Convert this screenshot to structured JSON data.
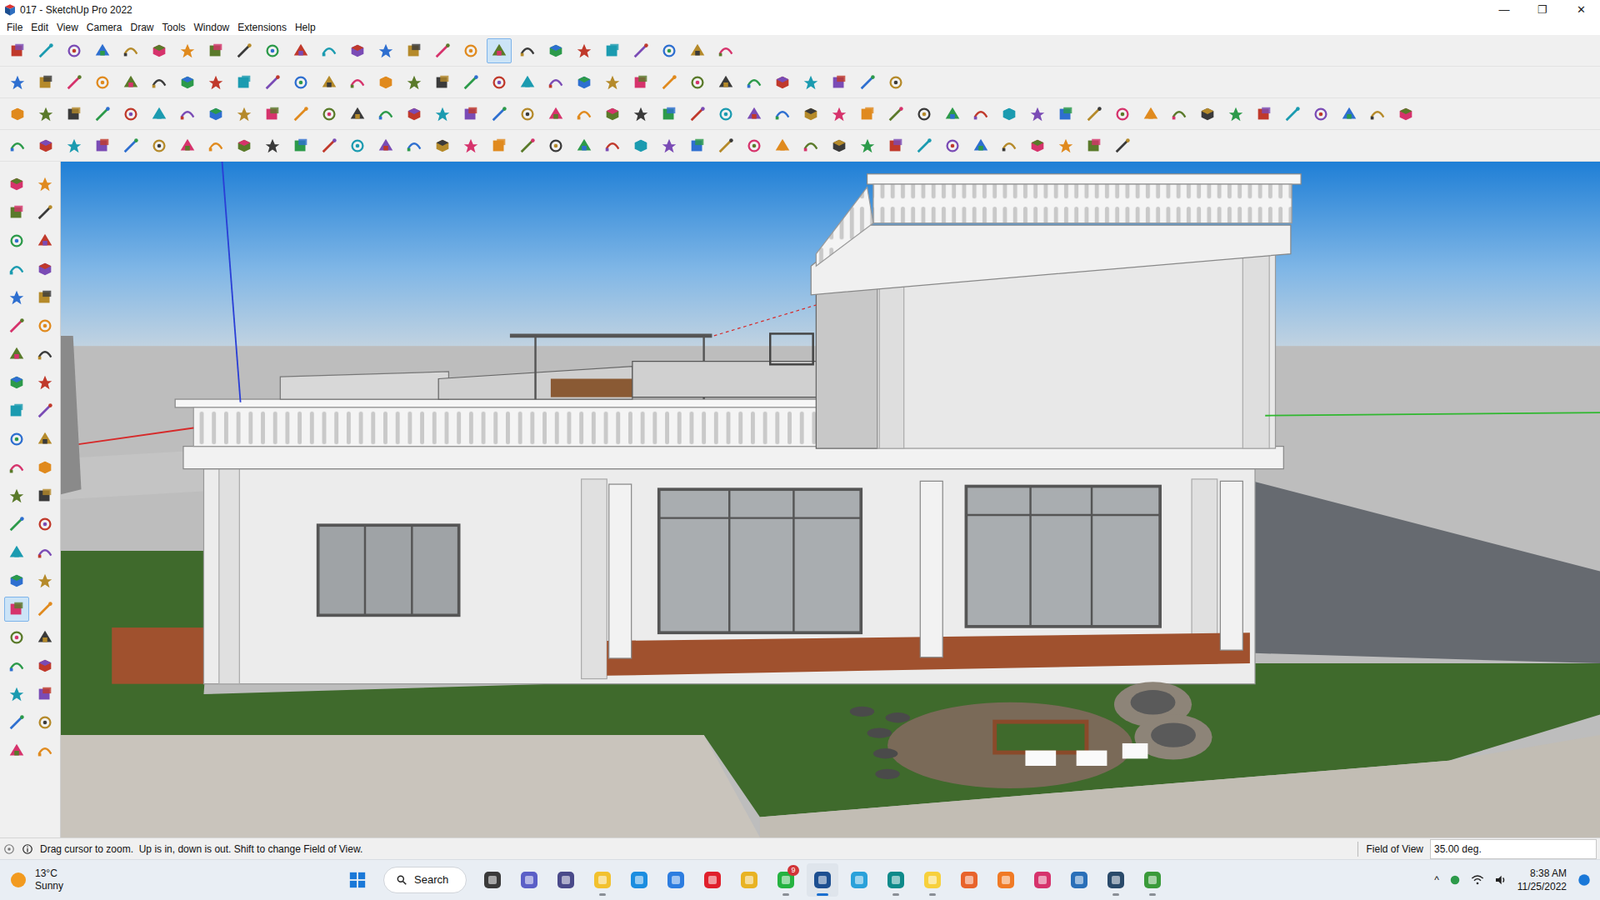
{
  "window": {
    "title": "017 - SketchUp Pro 2022",
    "controls": [
      "—",
      "❐",
      "✕"
    ]
  },
  "menu": [
    "File",
    "Edit",
    "View",
    "Camera",
    "Draw",
    "Tools",
    "Window",
    "Extensions",
    "Help"
  ],
  "toolbar_rows": [
    [
      false,
      false,
      false,
      false,
      false,
      false,
      false,
      false,
      false,
      false,
      false,
      false,
      false,
      false,
      false,
      false,
      false,
      true,
      false,
      false,
      false,
      false,
      false,
      false,
      false,
      false
    ],
    [
      false,
      false,
      false,
      false,
      false,
      false,
      false,
      false,
      false,
      false,
      false,
      false,
      false,
      false,
      false,
      false,
      false,
      false,
      false,
      false,
      false,
      false,
      false,
      false,
      false,
      false,
      false,
      false,
      false,
      false,
      false,
      false
    ],
    [
      false,
      false,
      false,
      false,
      false,
      false,
      false,
      false,
      false,
      false,
      false,
      false,
      false,
      false,
      false,
      false,
      false,
      false,
      false,
      false,
      false,
      false,
      false,
      false,
      false,
      false,
      false,
      false,
      false,
      false,
      false,
      false,
      false,
      false,
      false,
      false,
      false,
      false,
      false,
      false,
      false,
      false,
      false,
      false,
      false,
      false,
      false,
      false,
      false,
      false
    ],
    [
      false,
      false,
      false,
      false,
      false,
      false,
      false,
      false,
      false,
      false,
      false,
      false,
      false,
      false,
      false,
      false,
      false,
      false,
      false,
      false,
      false,
      false,
      false,
      false,
      false,
      false,
      false,
      false,
      false,
      false,
      false,
      false,
      false,
      false,
      false,
      false,
      false,
      false,
      false,
      false
    ]
  ],
  "left_toolbar": [
    false,
    false,
    false,
    false,
    false,
    false,
    false,
    false,
    false,
    false,
    false,
    false,
    false,
    false,
    false,
    false,
    false,
    false,
    false,
    false,
    false,
    false,
    false,
    false,
    false,
    false,
    false,
    false,
    false,
    false,
    true,
    false,
    false,
    false,
    false,
    false,
    false,
    false,
    false,
    false,
    false,
    false
  ],
  "status_bar": {
    "hint": "Drag cursor to zoom.  Up is in, down is out. Shift to change Field of View.",
    "field_label": "Field of View",
    "field_value": "35.00 deg."
  },
  "taskbar": {
    "weather": {
      "temp": "13°C",
      "condition": "Sunny"
    },
    "search": "Search",
    "apps": [
      {
        "color": "#3a3a3a",
        "running": false,
        "selected": false
      },
      {
        "color": "#5b5fc7",
        "running": false,
        "selected": false
      },
      {
        "color": "#4a4a8a",
        "running": false,
        "selected": false
      },
      {
        "color": "#f2c12e",
        "running": true,
        "selected": false
      },
      {
        "color": "#1b8de0",
        "running": false,
        "selected": false
      },
      {
        "color": "#2d7de0",
        "running": false,
        "selected": false
      },
      {
        "color": "#e0202c",
        "running": false,
        "selected": false
      },
      {
        "color": "#e8b323",
        "running": false,
        "selected": false
      },
      {
        "color": "#25b341",
        "running": true,
        "selected": false,
        "badge": "9"
      },
      {
        "color": "#1d4f91",
        "running": true,
        "selected": true
      },
      {
        "color": "#2aa1da",
        "running": false,
        "selected": false
      },
      {
        "color": "#0e8a8a",
        "running": true,
        "selected": false
      },
      {
        "color": "#f7d03c",
        "running": true,
        "selected": false
      },
      {
        "color": "#e8632b",
        "running": false,
        "selected": false
      },
      {
        "color": "#f07a25",
        "running": false,
        "selected": false
      },
      {
        "color": "#d6336c",
        "running": false,
        "selected": false
      },
      {
        "color": "#2a6fb8",
        "running": false,
        "selected": false
      },
      {
        "color": "#2a4a6a",
        "running": true,
        "selected": false
      },
      {
        "color": "#3a9a3a",
        "running": true,
        "selected": false
      }
    ],
    "tray": {
      "chevron": "^",
      "time": "8:38 AM",
      "date": "11/25/2022"
    }
  }
}
